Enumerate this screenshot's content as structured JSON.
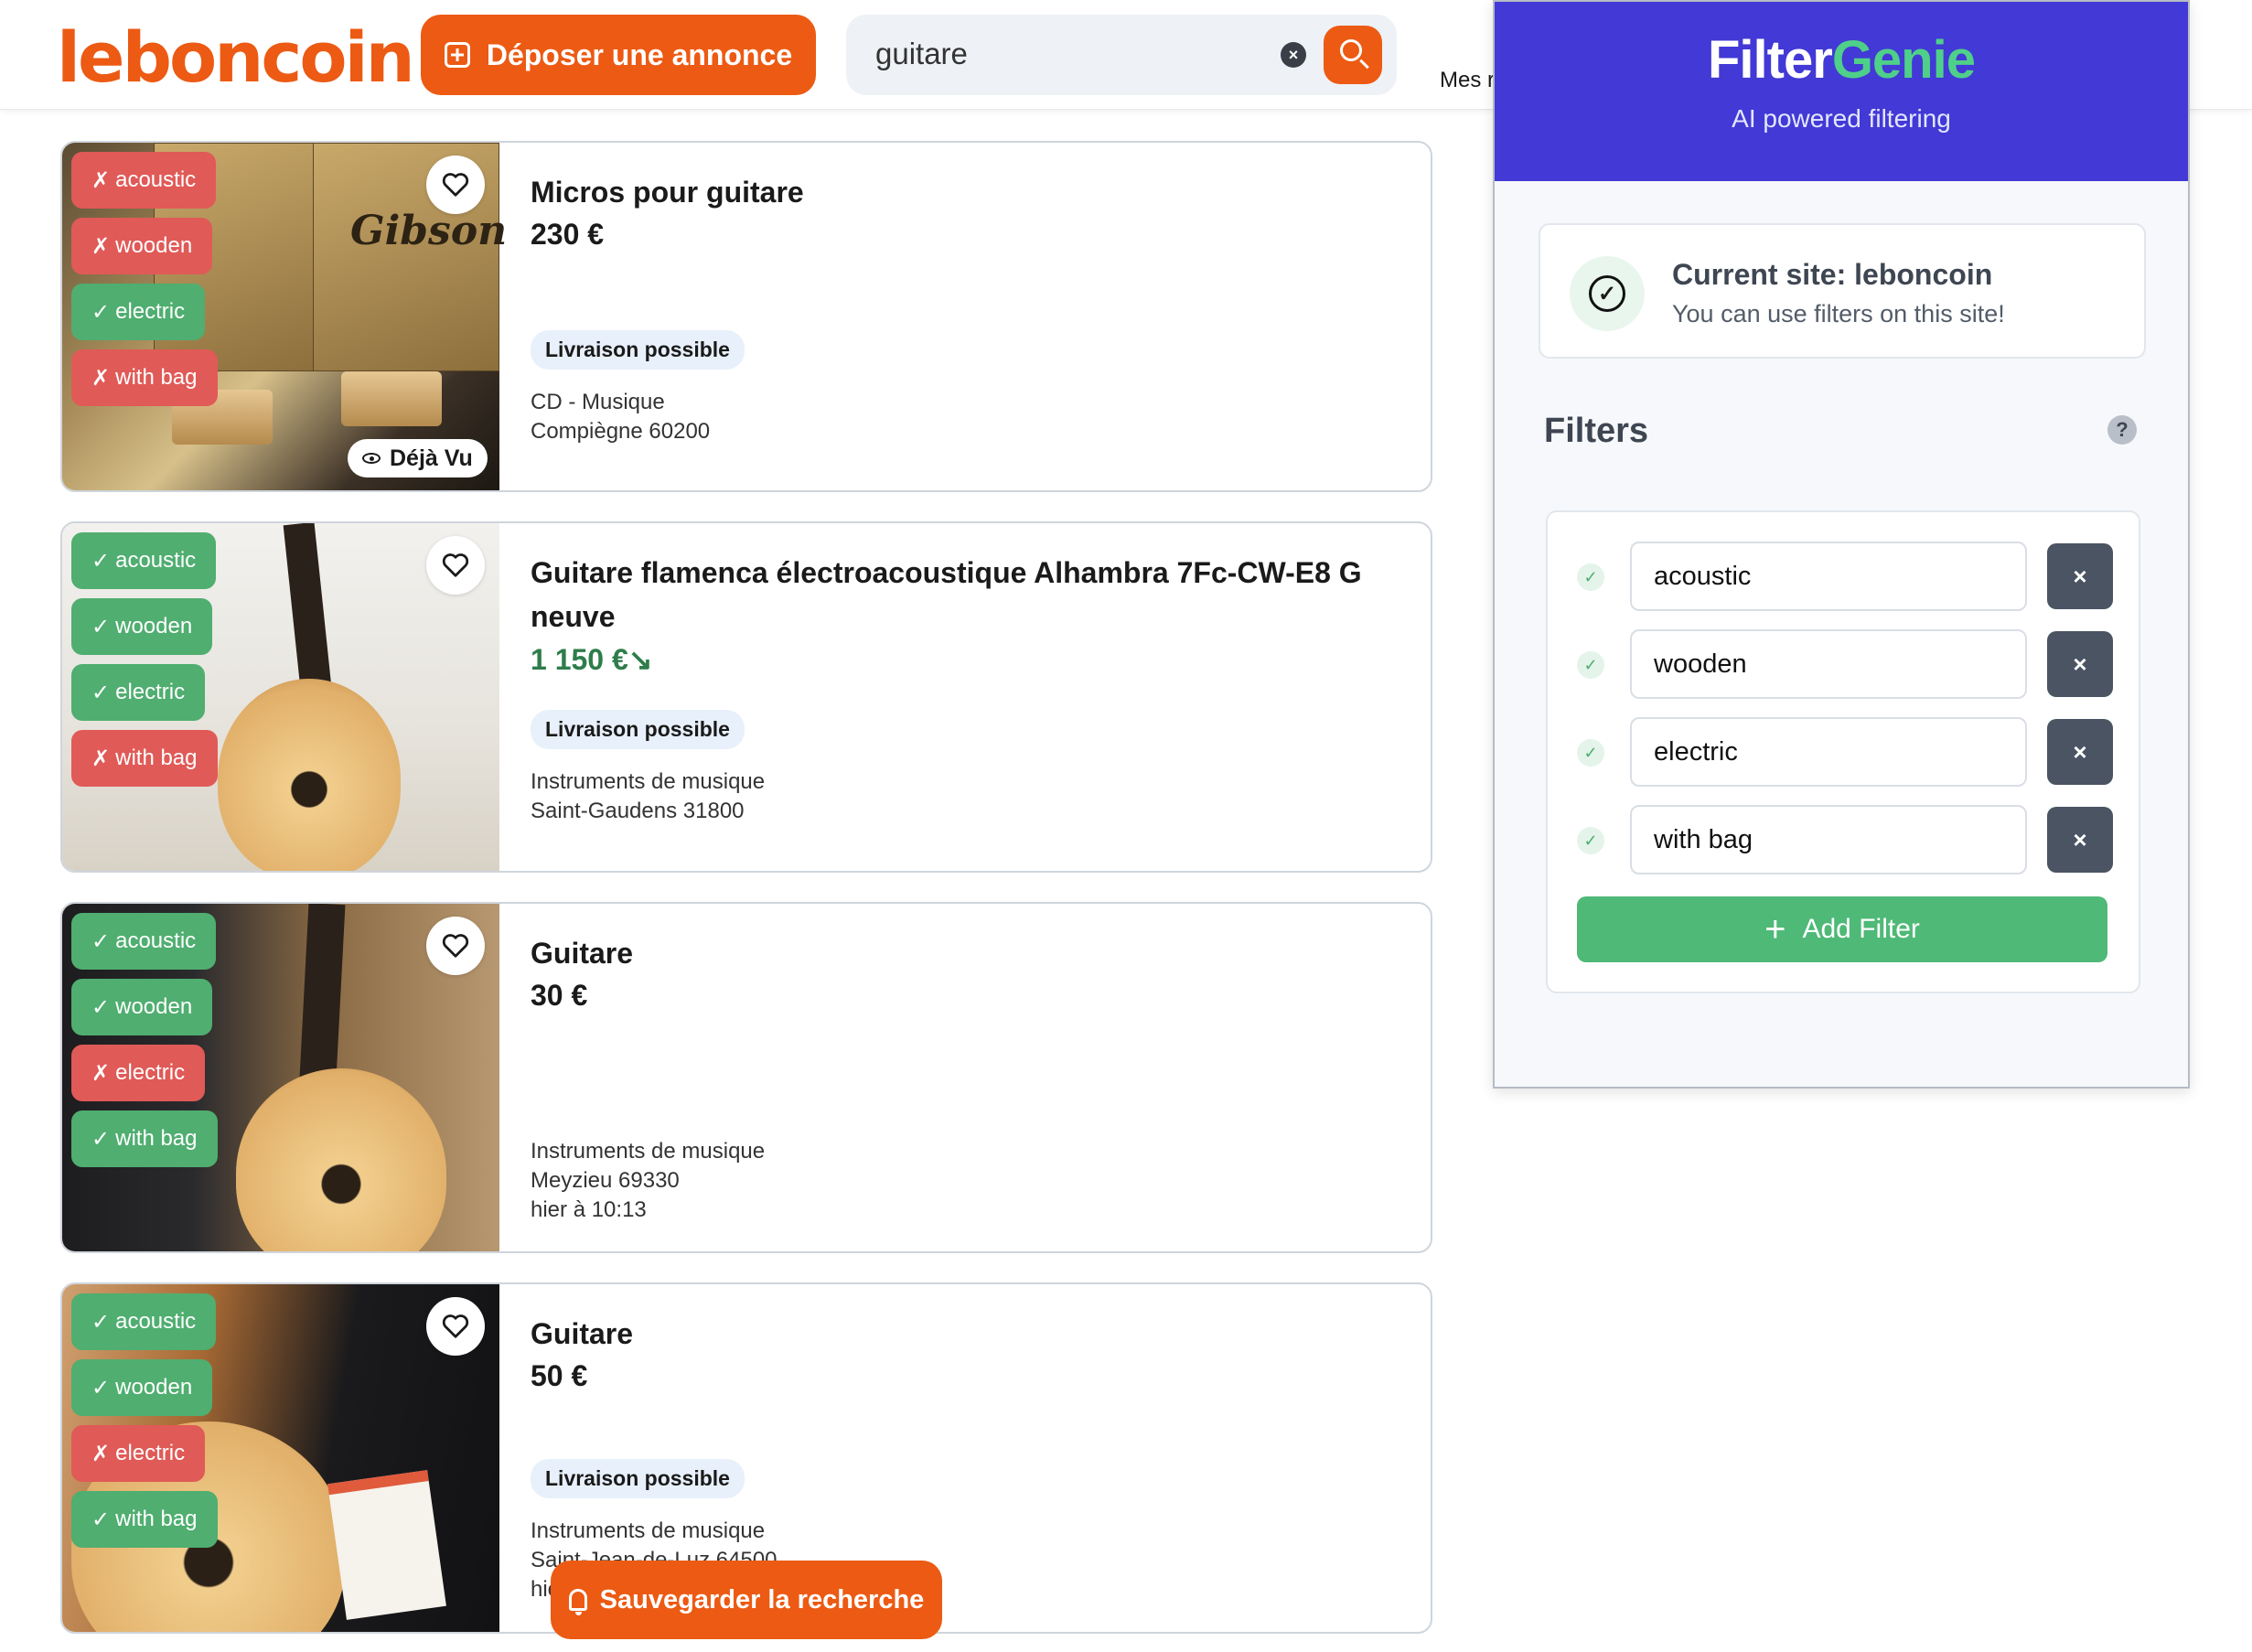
{
  "header": {
    "logo": "leboncoin",
    "post_label": "Déposer une annonce",
    "search_value": "guitare",
    "clear_label": "×",
    "mes_label": "Mes r"
  },
  "listings": [
    {
      "title": "Micros pour guitare",
      "price": "230 €",
      "price_trend": "",
      "delivery": "Livraison possible",
      "category": "CD - Musique",
      "location": "Compiègne 60200",
      "date": "",
      "seen_label": "Déjà Vu",
      "tags": [
        {
          "icon": "✗",
          "label": "acoustic",
          "match": false
        },
        {
          "icon": "✗",
          "label": "wooden",
          "match": false
        },
        {
          "icon": "✓",
          "label": "electric",
          "match": true
        },
        {
          "icon": "✗",
          "label": "with bag",
          "match": false
        }
      ]
    },
    {
      "title": "Guitare flamenca électroacoustique Alhambra 7Fc-CW-E8 G neuve",
      "price": "1 150 €",
      "price_trend": "↘",
      "delivery": "Livraison possible",
      "category": "Instruments de musique",
      "location": "Saint-Gaudens 31800",
      "date": "",
      "tags": [
        {
          "icon": "✓",
          "label": "acoustic",
          "match": true
        },
        {
          "icon": "✓",
          "label": "wooden",
          "match": true
        },
        {
          "icon": "✓",
          "label": "electric",
          "match": true
        },
        {
          "icon": "✗",
          "label": "with bag",
          "match": false
        }
      ]
    },
    {
      "title": "Guitare",
      "price": "30 €",
      "price_trend": "",
      "delivery": "",
      "category": "Instruments de musique",
      "location": "Meyzieu 69330",
      "date": "hier à 10:13",
      "tags": [
        {
          "icon": "✓",
          "label": "acoustic",
          "match": true
        },
        {
          "icon": "✓",
          "label": "wooden",
          "match": true
        },
        {
          "icon": "✗",
          "label": "electric",
          "match": false
        },
        {
          "icon": "✓",
          "label": "with bag",
          "match": true
        }
      ]
    },
    {
      "title": "Guitare",
      "price": "50 €",
      "price_trend": "",
      "delivery": "Livraison possible",
      "category": "Instruments de musique",
      "location": "Saint-Jean-de-Luz 64500",
      "date": "hie",
      "tags": [
        {
          "icon": "✓",
          "label": "acoustic",
          "match": true
        },
        {
          "icon": "✓",
          "label": "wooden",
          "match": true
        },
        {
          "icon": "✗",
          "label": "electric",
          "match": false
        },
        {
          "icon": "✓",
          "label": "with bag",
          "match": true
        }
      ]
    }
  ],
  "save_search_label": "Sauvegarder la recherche",
  "panel": {
    "brand_a": "Filter",
    "brand_b": "Genie",
    "tagline": "AI powered filtering",
    "site_title": "Current site: leboncoin",
    "site_sub": "You can use filters on this site!",
    "filters_title": "Filters",
    "help_label": "?",
    "filters": [
      {
        "value": "acoustic",
        "check": "✓",
        "delete": "×"
      },
      {
        "value": "wooden",
        "check": "✓",
        "delete": "×"
      },
      {
        "value": "electric",
        "check": "✓",
        "delete": "×"
      },
      {
        "value": "with bag",
        "check": "✓",
        "delete": "×"
      }
    ],
    "add_plus": "+",
    "add_label": "Add Filter"
  },
  "colors": {
    "brand_orange": "#ec5a13",
    "genie_purple": "#4239d6",
    "match_green": "#4fae70",
    "mismatch_red": "#e05a57"
  }
}
